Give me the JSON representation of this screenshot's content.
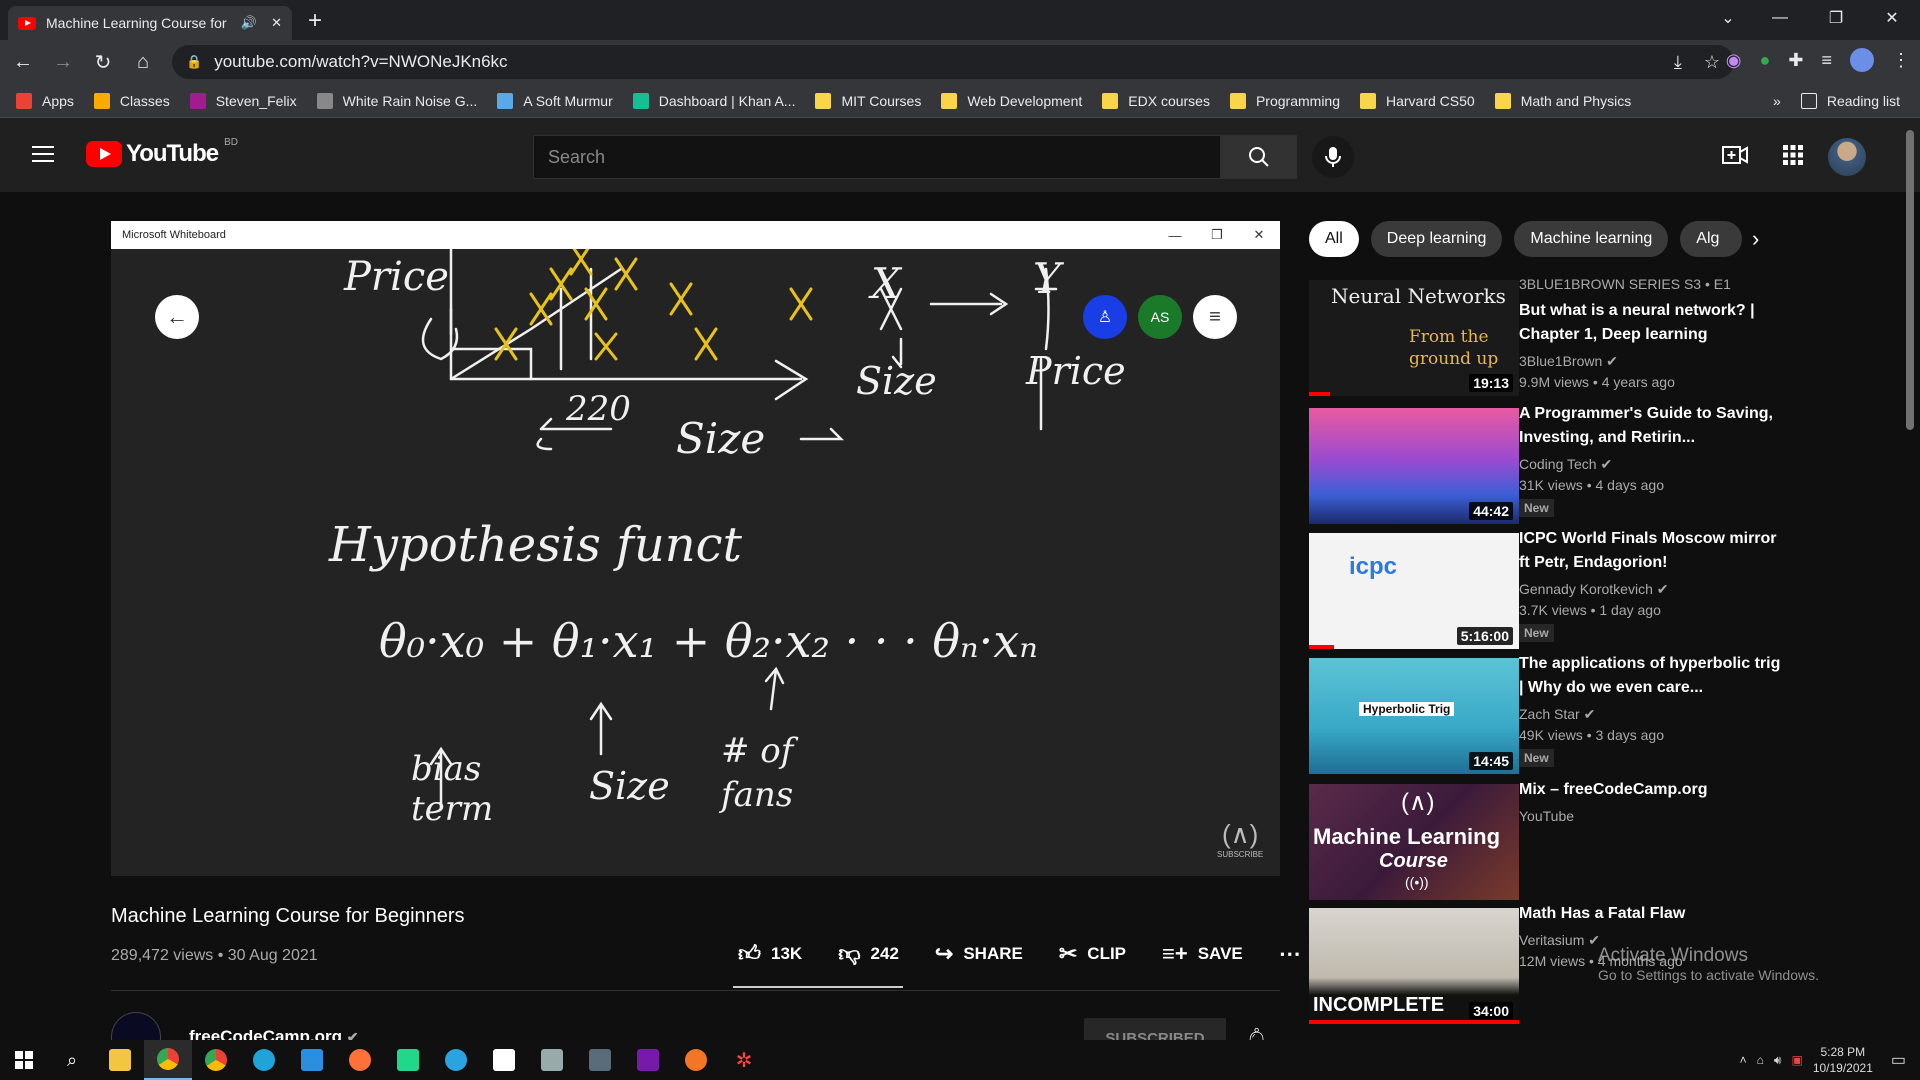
{
  "browser": {
    "tab_title": "Machine Learning Course for",
    "url": "youtube.com/watch?v=NWONeJKn6kc",
    "bookmarks": [
      {
        "label": "Apps",
        "icon": "apps-grid-icon",
        "color": "#ea4335"
      },
      {
        "label": "Classes",
        "icon": "classroom-icon",
        "color": "#f9ab00"
      },
      {
        "label": "Steven_Felix",
        "icon": "uva-icon",
        "color": "#a01c8f"
      },
      {
        "label": "White Rain Noise G...",
        "icon": "noise-icon",
        "color": "#888888"
      },
      {
        "label": "A Soft Murmur",
        "icon": "droplet-icon",
        "color": "#5aa9e6"
      },
      {
        "label": "Dashboard | Khan A...",
        "icon": "khan-icon",
        "color": "#14bf96"
      },
      {
        "label": "MIT Courses",
        "icon": "folder-icon",
        "color": "#f9d54a"
      },
      {
        "label": "Web Development",
        "icon": "folder-icon",
        "color": "#f9d54a"
      },
      {
        "label": "EDX courses",
        "icon": "folder-icon",
        "color": "#f9d54a"
      },
      {
        "label": "Programming",
        "icon": "folder-icon",
        "color": "#f9d54a"
      },
      {
        "label": "Harvard CS50",
        "icon": "folder-icon",
        "color": "#f9d54a"
      },
      {
        "label": "Math and Physics",
        "icon": "folder-icon",
        "color": "#f9d54a"
      }
    ],
    "more_label": "»",
    "reading_list": "Reading list"
  },
  "youtube": {
    "logo_text": "YouTube",
    "country": "BD",
    "search_placeholder": "Search"
  },
  "player": {
    "window_title": "Microsoft Whiteboard",
    "avatar_initials": "AS",
    "handwriting": {
      "price_top": "Price",
      "size_x": "Size",
      "value_220": "220",
      "x_label": "X",
      "y_label": "Y",
      "size_label": "Size",
      "price_label": "Price",
      "hypothesis": "Hypothesis funct",
      "formula": "θ₀·x₀ + θ₁·x₁ + θ₂·x₂ · · · θₙ·xₙ",
      "bias": "bias term",
      "size2": "Size",
      "fans": "# of fans"
    },
    "subscribe_watermark": "SUBSCRIBE"
  },
  "video": {
    "title": "Machine Learning Course for Beginners",
    "views_date": "289,472 views • 30 Aug 2021",
    "likes": "13K",
    "dislikes": "242",
    "share": "SHARE",
    "clip": "CLIP",
    "save": "SAVE",
    "channel": "freeCodeCamp.org",
    "subscribe": "SUBSCRIBED"
  },
  "chips": [
    "All",
    "Deep learning",
    "Machine learning",
    "Alg"
  ],
  "recommendations": [
    {
      "series": "3BLUE1BROWN SERIES  S3 • E1",
      "title": "But what is a neural network? | Chapter 1, Deep learning",
      "channel": "3Blue1Brown",
      "stats": "9.9M views • 4 years ago",
      "duration": "19:13",
      "new": "",
      "thumb_text": "Neural Networks",
      "thumb_sub": "From the ground up",
      "progress": 0.1
    },
    {
      "series": "",
      "title": "A Programmer's Guide to Saving, Investing, and Retirin...",
      "channel": "Coding Tech",
      "stats": "31K views • 4 days ago",
      "duration": "44:42",
      "new": "New",
      "thumb_text": "",
      "thumb_sub": "",
      "progress": 0
    },
    {
      "series": "",
      "title": "ICPC World Finals Moscow mirror ft Petr, Endagorion!",
      "channel": "Gennady Korotkevich",
      "stats": "3.7K views • 1 day ago",
      "duration": "5:16:00",
      "new": "New",
      "thumb_text": "icpc",
      "thumb_sub": "",
      "progress": 0.12
    },
    {
      "series": "",
      "title": "The applications of hyperbolic trig | Why do we even care...",
      "channel": "Zach Star",
      "stats": "49K views • 3 days ago",
      "duration": "14:45",
      "new": "New",
      "thumb_text": "Hyperbolic Trig",
      "thumb_sub": "",
      "progress": 0
    },
    {
      "series": "",
      "title": "Mix – freeCodeCamp.org",
      "channel": "YouTube",
      "stats": "",
      "duration": "",
      "new": "",
      "thumb_text": "Machine Learning",
      "thumb_sub": "Course",
      "progress": 0
    },
    {
      "series": "",
      "title": "Math Has a Fatal Flaw",
      "channel": "Veritasium",
      "stats": "12M views • 4 months ago",
      "duration": "34:00",
      "new": "",
      "thumb_text": "INCOMPLETE",
      "thumb_sub": "",
      "progress": 1.0
    }
  ],
  "activate_windows": {
    "title": "Activate Windows",
    "subtitle": "Go to Settings to activate Windows."
  },
  "taskbar": {
    "time": "5:28 PM",
    "date": "10/19/2021"
  }
}
